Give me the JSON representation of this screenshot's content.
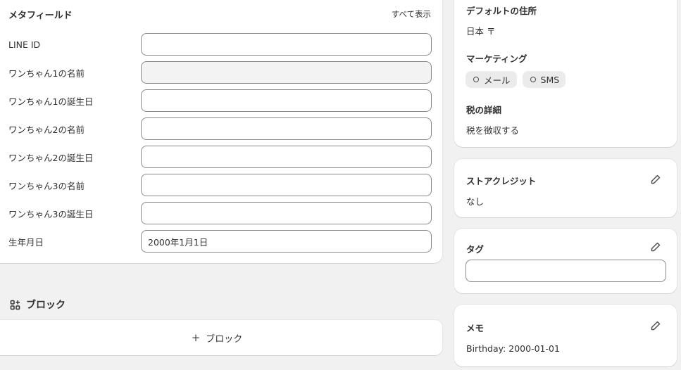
{
  "metafields": {
    "title": "メタフィールド",
    "show_all": "すべて表示",
    "fields": [
      {
        "label": "LINE ID",
        "value": "",
        "disabled": false
      },
      {
        "label": "ワンちゃん1の名前",
        "value": "",
        "disabled": true
      },
      {
        "label": "ワンちゃん1の誕生日",
        "value": "",
        "disabled": false
      },
      {
        "label": "ワンちゃん2の名前",
        "value": "",
        "disabled": false
      },
      {
        "label": "ワンちゃん2の誕生日",
        "value": "",
        "disabled": false
      },
      {
        "label": "ワンちゃん3の名前",
        "value": "",
        "disabled": false
      },
      {
        "label": "ワンちゃん3の誕生日",
        "value": "",
        "disabled": false
      },
      {
        "label": "生年月日",
        "value": "2000年1月1日",
        "disabled": false
      }
    ]
  },
  "blocks": {
    "title": "ブロック",
    "add_label": "ブロック",
    "add_symbol": "+"
  },
  "customer": {
    "default_address_title": "デフォルトの住所",
    "default_address_value": "日本 〒",
    "marketing_title": "マーケティング",
    "marketing_chips": [
      "メール",
      "SMS"
    ],
    "tax_title": "税の詳細",
    "tax_value": "税を徴収する"
  },
  "store_credit": {
    "title": "ストアクレジット",
    "value": "なし"
  },
  "tags": {
    "title": "タグ",
    "value": ""
  },
  "memo": {
    "title": "メモ",
    "value": "Birthday: 2000-01-01"
  },
  "icons": {
    "edit": "pencil-icon",
    "blocks": "blocks-icon",
    "chip": "circle-outline-icon"
  },
  "colors": {
    "background": "#f1f1f1",
    "card": "#ffffff",
    "text": "#303030",
    "input_border": "#8a8a8a",
    "chip_bg": "#ebebeb"
  }
}
